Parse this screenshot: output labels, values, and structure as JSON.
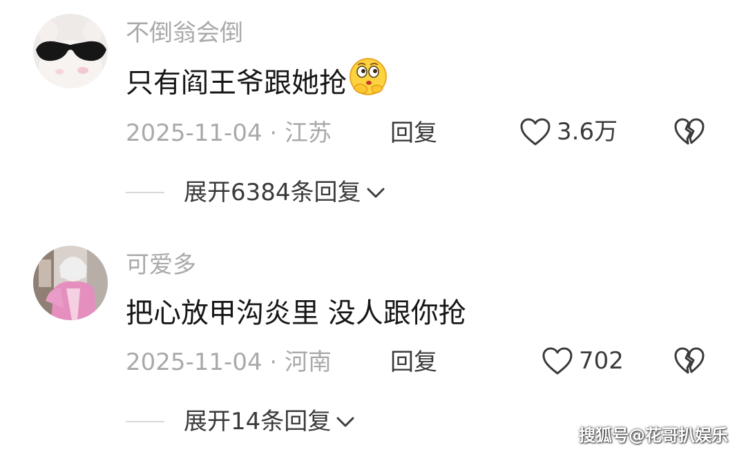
{
  "comments": [
    {
      "username": "不倒翁会倒",
      "content": "只有阎王爷跟她抢",
      "emoji": "thinking-face-emoji",
      "date": "2025-11-04 · 江苏",
      "reply_label": "回复",
      "likes": "3.6万",
      "expand_label": "展开6384条回复"
    },
    {
      "username": "可爱多",
      "content": "把心放甲沟炎里 没人跟你抢",
      "date": "2025-11-04 · 河南",
      "reply_label": "回复",
      "likes": "702",
      "expand_label": "展开14条回复"
    }
  ],
  "watermark": "搜狐号@花哥扒娱乐",
  "icons": {
    "like": "heart-outline-icon",
    "dislike": "broken-heart-icon",
    "expand": "chevron-down-icon"
  },
  "colors": {
    "text_primary": "#161616",
    "text_secondary": "#a9a9a9",
    "text_action": "#3a3a3a"
  }
}
